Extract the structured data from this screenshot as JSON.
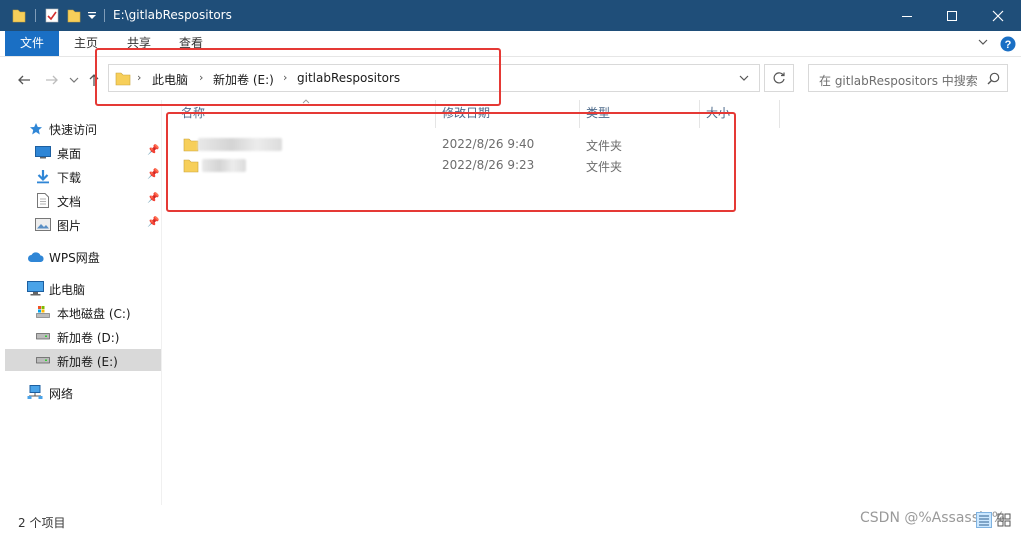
{
  "window": {
    "title": "E:\\gitlabRespositors"
  },
  "ribbon": {
    "tabs": [
      {
        "label": "文件"
      },
      {
        "label": "主页"
      },
      {
        "label": "共享"
      },
      {
        "label": "查看"
      }
    ]
  },
  "address": {
    "crumbs": [
      "此电脑",
      "新加卷 (E:)",
      "gitlabRespositors"
    ]
  },
  "search": {
    "placeholder": "在 gitlabRespositors 中搜索"
  },
  "sidebar": {
    "items": [
      {
        "label": "快速访问"
      },
      {
        "label": "桌面"
      },
      {
        "label": "下载"
      },
      {
        "label": "文档"
      },
      {
        "label": "图片"
      },
      {
        "label": "WPS网盘"
      },
      {
        "label": "此电脑"
      },
      {
        "label": "本地磁盘 (C:)"
      },
      {
        "label": "新加卷 (D:)"
      },
      {
        "label": "新加卷 (E:)"
      },
      {
        "label": "网络"
      }
    ]
  },
  "columns": {
    "name": "名称",
    "modified": "修改日期",
    "type": "类型",
    "size": "大小"
  },
  "files": [
    {
      "modified": "2022/8/26 9:40",
      "type": "文件夹"
    },
    {
      "modified": "2022/8/26 9:23",
      "type": "文件夹"
    }
  ],
  "status": {
    "count": "2 个项目"
  },
  "watermark": "CSDN @%Assassin%",
  "colors": {
    "titlebar": "#1f4e79",
    "accent": "#1a6fc4",
    "highlight": "#e53935",
    "folder": "#f7cf5a"
  }
}
